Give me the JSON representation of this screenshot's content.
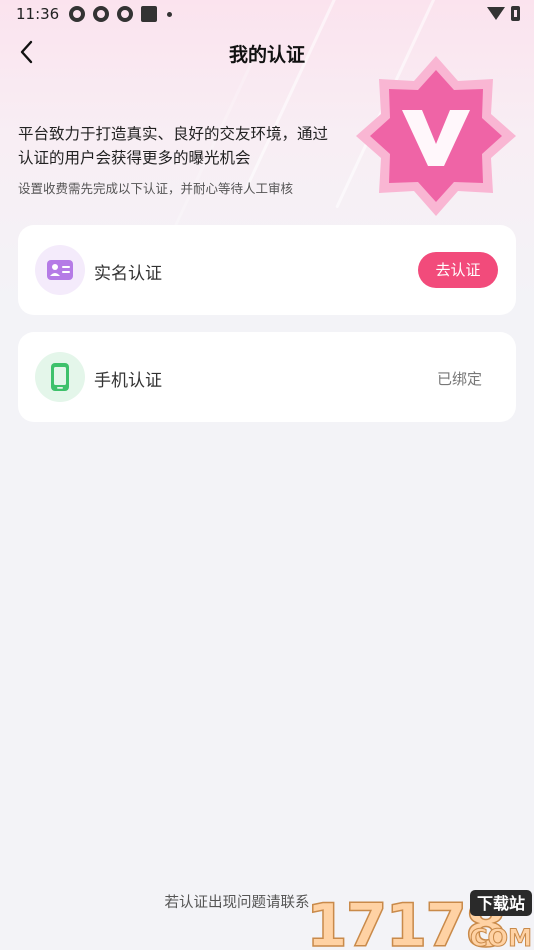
{
  "status_bar": {
    "time": "11:36"
  },
  "header": {
    "title": "我的认证"
  },
  "intro": {
    "main": "平台致力于打造真实、良好的交友环境，通过认证的用户会获得更多的曝光机会",
    "sub": "设置收费需先完成以下认证，并耐心等待人工审核"
  },
  "badge": {
    "letter": "V",
    "colors": {
      "outer": "#f7a9cc",
      "inner": "#ef5fa1",
      "letter": "#ffffff"
    }
  },
  "items": [
    {
      "label": "实名认证",
      "icon": "id-card-icon",
      "action": "去认证",
      "icon_bg": "#f4ebfb",
      "icon_color": "#b57be6"
    },
    {
      "label": "手机认证",
      "icon": "phone-icon",
      "status": "已绑定",
      "icon_bg": "#e4f6ea",
      "icon_color": "#3ec16b"
    }
  ],
  "footer": {
    "note": "若认证出现问题请联系"
  },
  "watermark": {
    "number": "17178",
    "top_text": "下载站",
    "bottom_text": "COM"
  },
  "colors": {
    "accent": "#f24b7b",
    "background": "#f3f3f7"
  }
}
